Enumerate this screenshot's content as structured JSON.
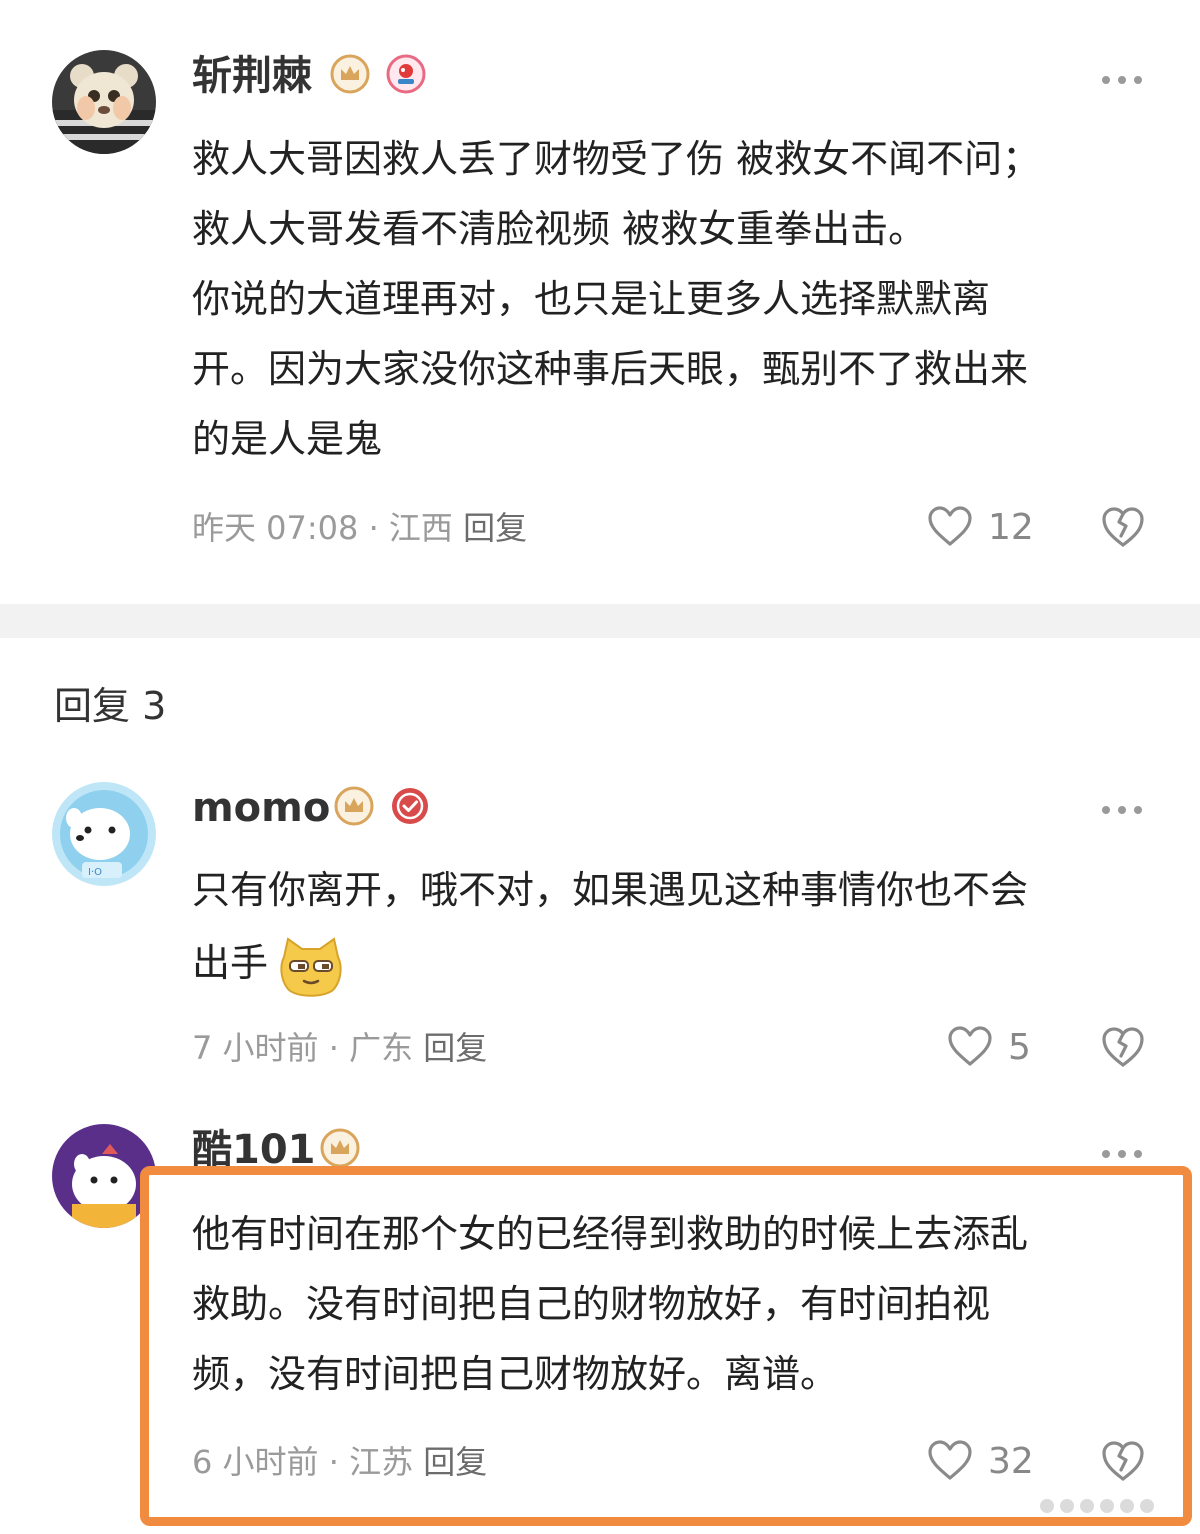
{
  "comment": {
    "username": "斩荆棘",
    "text_lines": [
      "救人大哥因救人丢了财物受了伤 被救女不闻不问；",
      "救人大哥发看不清脸视频 被救女重拳出击。",
      "你说的大道理再对，也只是让更多人选择默默离",
      "开。因为大家没你这种事后天眼，甄别不了救出来",
      "的是人是鬼"
    ],
    "time": "昨天 07:08",
    "separator": "·",
    "location": "江西",
    "reply_label": "回复",
    "like_count": "12"
  },
  "replies_section": {
    "title": "回复 3"
  },
  "replies": [
    {
      "username": "momo",
      "text_lines": [
        "只有你离开，哦不对，如果遇见这种事情你也不会",
        "出手"
      ],
      "time": "7 小时前",
      "separator": "·",
      "location": "广东",
      "reply_label": "回复",
      "like_count": "5"
    },
    {
      "username": "酷101",
      "text_lines": [
        "他有时间在那个女的已经得到救助的时候上去添乱",
        "救助。没有时间把自己的财物放好，有时间拍视",
        "频，没有时间把自己财物放好。离谱。"
      ],
      "time": "6 小时前",
      "separator": "·",
      "location": "江苏",
      "reply_label": "回复",
      "like_count": "32"
    }
  ],
  "colors": {
    "highlight_border": "#f08b3f",
    "badge_gold": "#d9a45b",
    "badge_red": "#d94a4a",
    "meta_gray": "#9a9a9a"
  },
  "icons": {
    "crown_badge": "crown-badge-icon",
    "medal_badge": "medal-badge-icon",
    "verified_badge": "verified-badge-icon",
    "like": "heart-icon",
    "dislike": "broken-heart-icon",
    "more": "more-dots-icon",
    "emoji": "smirk-cat-emoji"
  }
}
